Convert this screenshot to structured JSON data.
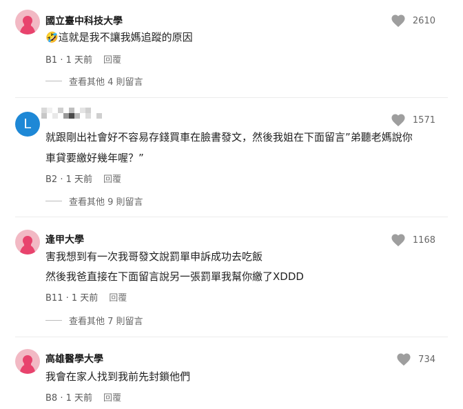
{
  "comments": [
    {
      "author": "國立臺中科技大學",
      "lines": [
        "🤣這就是我不讓我媽追蹤的原因"
      ],
      "floor": "B1",
      "time": "1 天前",
      "reply": "回覆",
      "likes": "2610",
      "more": "查看其他 4 則留言",
      "avatar": "pink-silhouette-avatar"
    },
    {
      "author": "",
      "lines": [
        "就跟剛出社會好不容易存錢買車在臉書發文，然後我姐在下面留言”弟聽老媽說你",
        "車貸要繳好幾年喔？”"
      ],
      "floor": "B2",
      "time": "1 天前",
      "reply": "回覆",
      "likes": "1571",
      "more": "查看其他 9 則留言",
      "avatar_letter": "L",
      "avatar_color": "#1e88d6"
    },
    {
      "author": "逢甲大學",
      "lines": [
        "害我想到有一次我哥發文說罰單申訴成功去吃飯",
        "然後我爸直接在下面留言說另一張罰單我幫你繳了XDDD"
      ],
      "floor": "B11",
      "time": "1 天前",
      "reply": "回覆",
      "likes": "1168",
      "more": "查看其他 7 則留言",
      "avatar": "pink-silhouette-avatar"
    },
    {
      "author": "高雄醫學大學",
      "lines": [
        "我會在家人找到我前先封鎖他們"
      ],
      "floor": "B8",
      "time": "1 天前",
      "reply": "回覆",
      "likes": "734",
      "avatar": "pink-silhouette-avatar"
    }
  ],
  "colors": {
    "heart": "#9e9e9e",
    "avatar_pink": "#f2b9c4",
    "avatar_figure": "#e8436d"
  }
}
